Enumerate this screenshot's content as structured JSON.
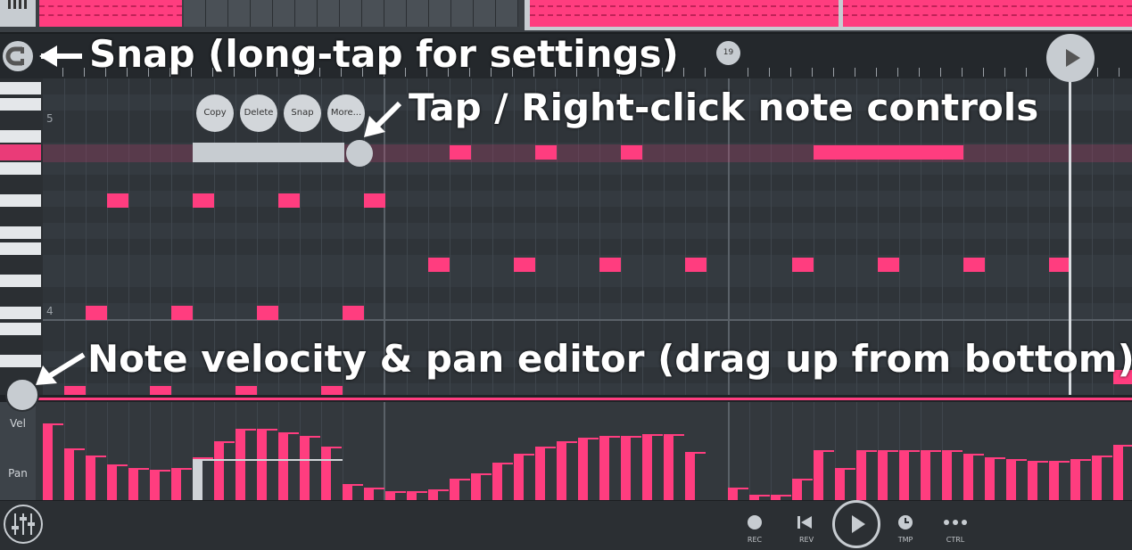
{
  "timeline": {
    "bar_marker": "19"
  },
  "piano": {
    "octave_5": "5",
    "octave_4": "4"
  },
  "popup": {
    "copy": "Copy",
    "delete": "Delete",
    "snap": "Snap",
    "more": "More..."
  },
  "callouts": {
    "snap": "Snap (long-tap for settings)",
    "note_controls": "Tap / Right-click note controls",
    "velocity": "Note velocity & pan editor (drag up from bottom)"
  },
  "editor": {
    "vel_label": "Vel",
    "pan_label": "Pan"
  },
  "transport": {
    "rec": "REC",
    "rev": "REV",
    "tmp": "TMP",
    "ctrl": "CTRL"
  },
  "colors": {
    "accent": "#ff3d7f",
    "bg": "#2b2f33",
    "ui_light": "#c7ccd1"
  }
}
